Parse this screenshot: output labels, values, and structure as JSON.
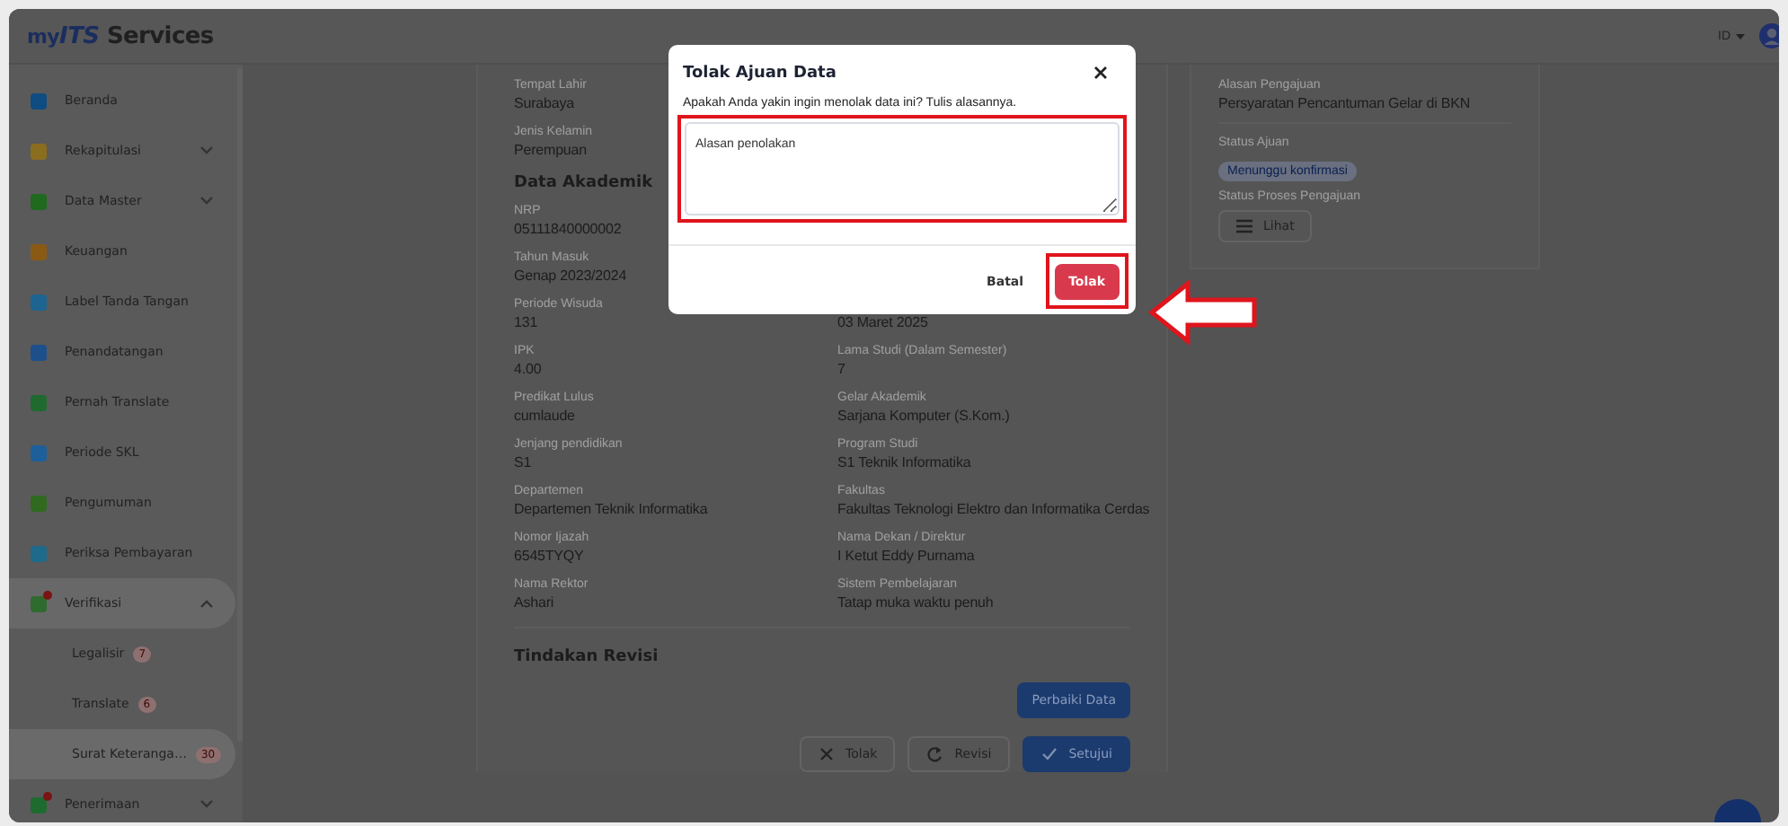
{
  "header": {
    "logo": {
      "prefix": "my",
      "brand": "ITS",
      "suffix": " Services"
    },
    "language": "ID"
  },
  "sidebar": {
    "items": [
      {
        "label": "Beranda",
        "color": "#0f4c81",
        "kind": "link",
        "alert": false,
        "selected": false
      },
      {
        "label": "Rekapitulasi",
        "color": "#8a6d1e",
        "kind": "group",
        "expanded": false,
        "alert": false,
        "selected": false
      },
      {
        "label": "Data Master",
        "color": "#1f6a1f",
        "kind": "group",
        "expanded": false,
        "alert": false,
        "selected": false
      },
      {
        "label": "Keuangan",
        "color": "#8a5a14",
        "kind": "link",
        "alert": false,
        "selected": false
      },
      {
        "label": "Label Tanda Tangan",
        "color": "#1d6590",
        "kind": "link",
        "alert": false,
        "selected": false
      },
      {
        "label": "Penandatangan",
        "color": "#1d4f8a",
        "kind": "link",
        "alert": false,
        "selected": false
      },
      {
        "label": "Pernah Translate",
        "color": "#1f6a2f",
        "kind": "link",
        "alert": false,
        "selected": false
      },
      {
        "label": "Periode SKL",
        "color": "#1d5f9a",
        "kind": "link",
        "alert": false,
        "selected": false
      },
      {
        "label": "Pengumuman",
        "color": "#2f6a1f",
        "kind": "link",
        "alert": false,
        "selected": false
      },
      {
        "label": "Periksa Pembayaran",
        "color": "#1d6a8a",
        "kind": "link",
        "alert": false,
        "selected": false
      },
      {
        "label": "Verifikasi",
        "color": "#2f6a2f",
        "kind": "group",
        "expanded": true,
        "alert": true,
        "selected": true,
        "children": [
          {
            "label": "Legalisir",
            "badge": "7",
            "selected": false
          },
          {
            "label": "Translate",
            "badge": "6",
            "selected": false
          },
          {
            "label": "Surat Keteranga…",
            "badge": "30",
            "selected": true
          }
        ]
      },
      {
        "label": "Penerimaan",
        "color": "#1f6a2f",
        "kind": "group",
        "expanded": false,
        "alert": true,
        "selected": false
      }
    ]
  },
  "detail": {
    "blocks": [
      {
        "kind": "pair",
        "left": {
          "label": "Tempat Lahir",
          "value": "Surabaya"
        }
      },
      {
        "kind": "pair",
        "left": {
          "label": "Jenis Kelamin",
          "value": "Perempuan"
        }
      },
      {
        "kind": "heading",
        "text": "Data Akademik"
      },
      {
        "kind": "pair",
        "left": {
          "label": "NRP",
          "value": "05111840000002"
        }
      },
      {
        "kind": "pair",
        "left": {
          "label": "Tahun Masuk",
          "value": "Genap 2023/2024"
        }
      },
      {
        "kind": "pair",
        "left": {
          "label": "Periode Wisuda",
          "value": "131"
        },
        "right": {
          "value": "03 Maret 2025"
        }
      },
      {
        "kind": "pair",
        "left": {
          "label": "IPK",
          "value": "4.00"
        },
        "right": {
          "label": "Lama Studi (Dalam Semester)",
          "value": "7"
        }
      },
      {
        "kind": "pair",
        "left": {
          "label": "Predikat Lulus",
          "value": "cumlaude"
        },
        "right": {
          "label": "Gelar Akademik",
          "value": "Sarjana Komputer (S.Kom.)"
        }
      },
      {
        "kind": "pair",
        "left": {
          "label": "Jenjang pendidikan",
          "value": "S1"
        },
        "right": {
          "label": "Program Studi",
          "value": "S1 Teknik Informatika"
        }
      },
      {
        "kind": "pair",
        "left": {
          "label": "Departemen",
          "value": "Departemen Teknik Informatika"
        },
        "right": {
          "label": "Fakultas",
          "value": "Fakultas Teknologi Elektro dan Informatika Cerdas"
        }
      },
      {
        "kind": "pair",
        "left": {
          "label": "Nomor Ijazah",
          "value": "6545TYQY"
        },
        "right": {
          "label": "Nama Dekan / Direktur",
          "value": "I Ketut Eddy Purnama"
        }
      },
      {
        "kind": "pair",
        "left": {
          "label": "Nama Rektor",
          "value": "Ashari"
        },
        "right": {
          "label": "Sistem Pembelajaran",
          "value": "Tatap muka waktu penuh"
        }
      }
    ],
    "revision": {
      "title": "Tindakan Revisi",
      "fix_button": "Perbaiki Data"
    },
    "actions": [
      {
        "label": "Tolak",
        "kind": "reject"
      },
      {
        "label": "Revisi",
        "kind": "revise"
      },
      {
        "label": "Setujui",
        "kind": "approve"
      }
    ]
  },
  "side_card": {
    "reason_label": "Alasan Pengajuan",
    "reason": "Persyaratan Pencantuman Gelar di BKN",
    "status_label": "Status Ajuan",
    "status": "Menunggu konfirmasi",
    "process_label": "Status Proses Pengajuan",
    "view_button": "Lihat"
  },
  "modal": {
    "title": "Tolak Ajuan Data",
    "message": "Apakah Anda yakin ingin menolak data ini? Tulis alasannya.",
    "reason_field": {
      "placeholder": "Alasan penolakan",
      "highlighted": true
    },
    "cancel": "Batal",
    "confirm": {
      "label": "Tolak",
      "highlighted": true,
      "arrow": true
    }
  }
}
